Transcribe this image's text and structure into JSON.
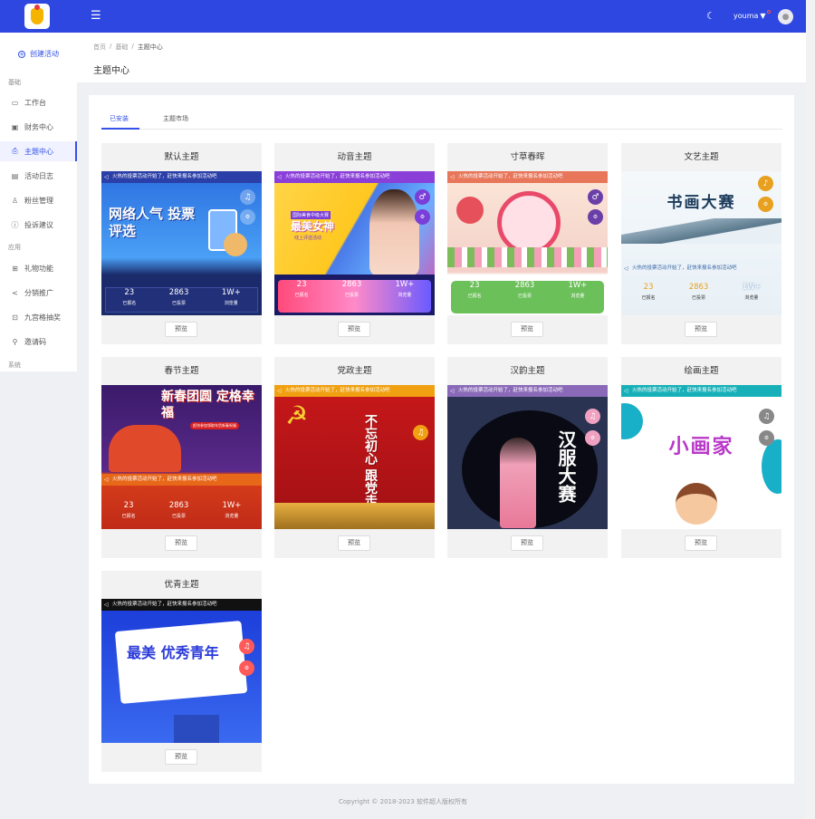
{
  "user": {
    "name": "youma"
  },
  "sidebar": {
    "create_label": "创建活动",
    "sections": [
      "基础",
      "应用",
      "系统"
    ],
    "items": [
      {
        "label": "工作台",
        "icon": "monitor-icon"
      },
      {
        "label": "财务中心",
        "icon": "wallet-icon"
      },
      {
        "label": "主题中心",
        "icon": "printer-icon"
      },
      {
        "label": "活动日志",
        "icon": "log-icon"
      },
      {
        "label": "粉丝管理",
        "icon": "user-icon"
      },
      {
        "label": "投诉建议",
        "icon": "alert-icon"
      },
      {
        "label": "礼物功能",
        "icon": "gift-icon"
      },
      {
        "label": "分销推广",
        "icon": "share-icon"
      },
      {
        "label": "九宫格抽奖",
        "icon": "grid-icon"
      },
      {
        "label": "邀请码",
        "icon": "key-icon"
      }
    ]
  },
  "breadcrumb": [
    "首页",
    "基础",
    "主题中心"
  ],
  "page_title": "主题中心",
  "tabs": [
    "已安装",
    "主题市场"
  ],
  "preview_label": "预览",
  "notice": "火热的投票活动开始了，赶快来报名参加活动吧",
  "stats": {
    "v1": "23",
    "v2": "2863",
    "v3": "1W+",
    "l1": "已报名",
    "l2": "已投票",
    "l3": "浏览量"
  },
  "banner_text": {
    "moren": "网络人气 投票评选",
    "dongyin_small": "国际美食中级大赛",
    "dongyin": "最美女神",
    "dongyin_sub": "线上评选活动",
    "wenyi": "书画大赛",
    "chunjie": "新春团圆 定格幸福",
    "chunjie_sub": "赶快参加领取年货新春祝福",
    "dangzheng": "不忘初心 跟党走",
    "hanyun": "汉服大赛",
    "huihua": "小画家",
    "youqing": "最美 优秀青年"
  },
  "cards": [
    {
      "title": "默认主题"
    },
    {
      "title": "动音主题"
    },
    {
      "title": "寸草春晖"
    },
    {
      "title": "文艺主题"
    },
    {
      "title": "春节主题"
    },
    {
      "title": "党政主题"
    },
    {
      "title": "汉韵主题"
    },
    {
      "title": "绘画主题"
    },
    {
      "title": "优青主题"
    }
  ],
  "footer": "Copyright © 2018-2023 软件超人版权所有",
  "colors": {
    "primary": "#2d47e0",
    "accent": "#3452e8"
  }
}
